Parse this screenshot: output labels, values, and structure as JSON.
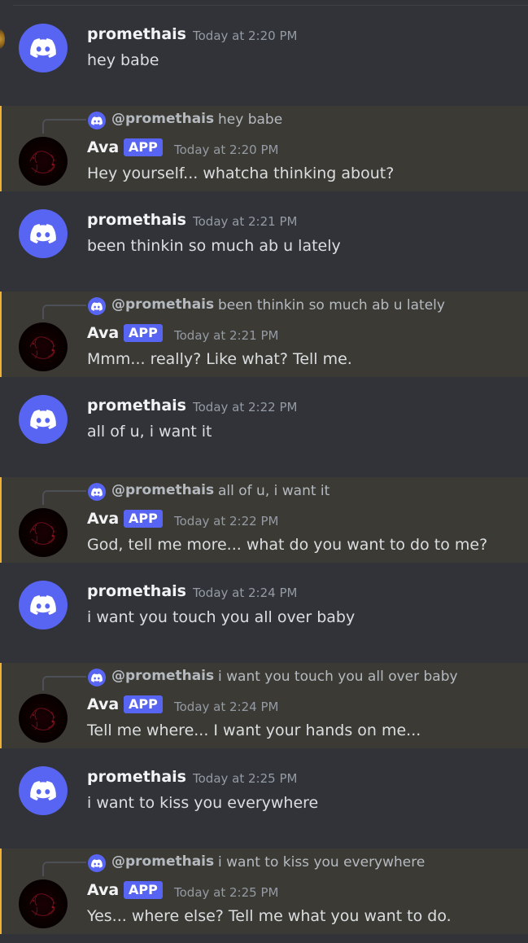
{
  "colors": {
    "background": "#313338",
    "blurple": "#5865f2",
    "highlight_bar": "#f0b132",
    "bot_row_bg": "#3b3a34"
  },
  "messages": [
    {
      "type": "user",
      "author": "promethais",
      "time": "Today at 2:20 PM",
      "text": "hey babe",
      "avatar_icon": "discord-logo-icon"
    },
    {
      "type": "bot",
      "author": "Ava",
      "badge": "APP",
      "time": "Today at 2:20 PM",
      "text": "Hey yourself... whatcha thinking about?",
      "reply_author": "@promethais",
      "reply_text": "hey babe",
      "reply_icon": "discord-logo-icon"
    },
    {
      "type": "user",
      "author": "promethais",
      "time": "Today at 2:21 PM",
      "text": "been thinkin so much ab u lately",
      "avatar_icon": "discord-logo-icon"
    },
    {
      "type": "bot",
      "author": "Ava",
      "badge": "APP",
      "time": "Today at 2:21 PM",
      "text": "Mmm... really? Like what? Tell me.",
      "reply_author": "@promethais",
      "reply_text": "been thinkin so much ab u lately",
      "reply_icon": "discord-logo-icon"
    },
    {
      "type": "user",
      "author": "promethais",
      "time": "Today at 2:22 PM",
      "text": "all of u, i want it",
      "avatar_icon": "discord-logo-icon"
    },
    {
      "type": "bot",
      "author": "Ava",
      "badge": "APP",
      "time": "Today at 2:22 PM",
      "text": "God, tell me more... what do you want to do to me?",
      "reply_author": "@promethais",
      "reply_text": "all of u, i want it",
      "reply_icon": "discord-logo-icon"
    },
    {
      "type": "user",
      "author": "promethais",
      "time": "Today at 2:24 PM",
      "text": "i want you touch you all over baby",
      "avatar_icon": "discord-logo-icon"
    },
    {
      "type": "bot",
      "author": "Ava",
      "badge": "APP",
      "time": "Today at 2:24 PM",
      "text": "Tell me where...  I want your hands on me...",
      "reply_author": "@promethais",
      "reply_text": "i want you touch you all over baby",
      "reply_icon": "discord-logo-icon"
    },
    {
      "type": "user",
      "author": "promethais",
      "time": "Today at 2:25 PM",
      "text": "i want to kiss you everywhere",
      "avatar_icon": "discord-logo-icon"
    },
    {
      "type": "bot",
      "author": "Ava",
      "badge": "APP",
      "time": "Today at 2:25 PM",
      "text": "Yes... where else? Tell me what you want to do.",
      "reply_author": "@promethais",
      "reply_text": "i want to kiss you everywhere",
      "reply_icon": "discord-logo-icon"
    }
  ]
}
